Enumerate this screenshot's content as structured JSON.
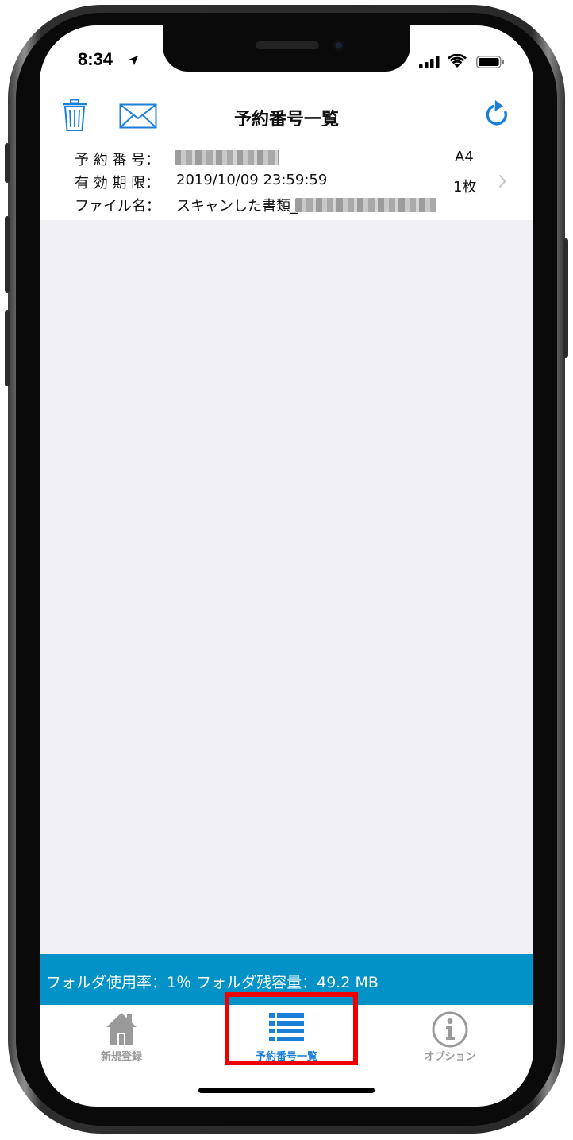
{
  "status_bar": {
    "time": "8:34"
  },
  "nav": {
    "title": "予約番号一覧"
  },
  "reservation": {
    "number_label": "予 約 番 号：",
    "expiry_label": "有 効 期 限：",
    "expiry_value": "2019/10/09 23:59:59",
    "filename_label": "ファイル名：",
    "filename_value": "スキャンした書類_",
    "paper_size": "A4",
    "page_count": "1枚"
  },
  "storage": {
    "text": "フォルダ使用率：1％ フォルダ残容量：49.2 MB"
  },
  "tabs": [
    {
      "label": "新規登録",
      "icon": "home-icon"
    },
    {
      "label": "予約番号一覧",
      "icon": "list-icon"
    },
    {
      "label": "オプション",
      "icon": "info-icon"
    }
  ],
  "colors": {
    "accent": "#1a7fd9",
    "storage_bar": "#0292c7",
    "tab_inactive": "#9a9a9a",
    "highlight": "#ee0000"
  }
}
